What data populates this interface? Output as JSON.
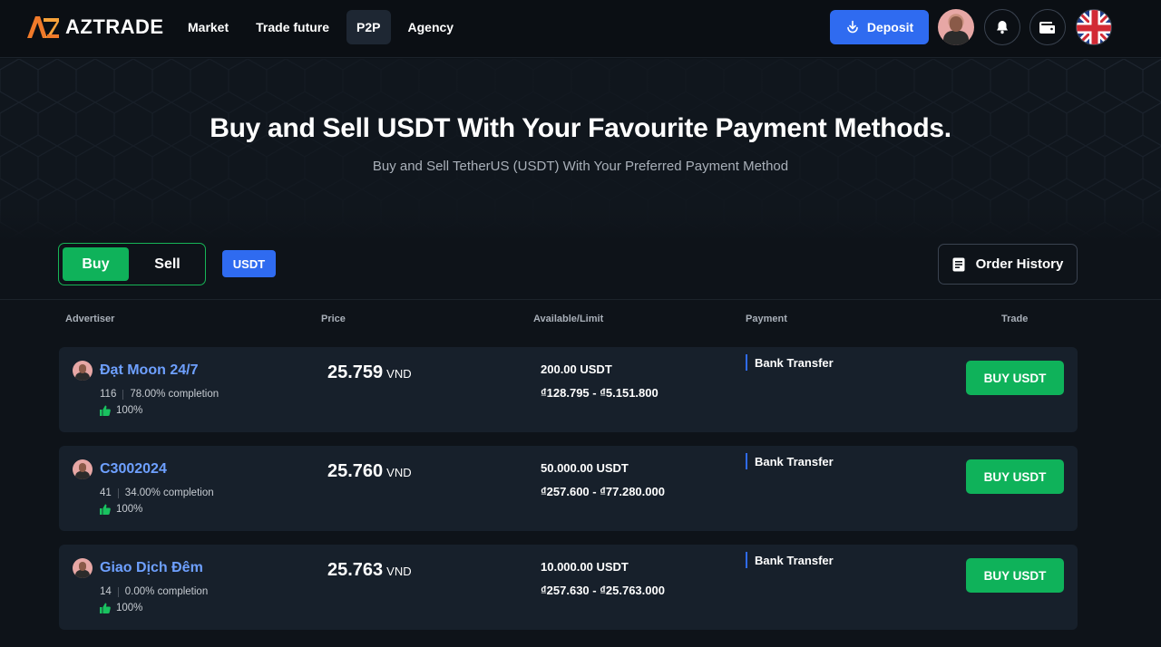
{
  "header": {
    "brand": "AZTRADE",
    "nav": [
      {
        "label": "Market",
        "active": false
      },
      {
        "label": "Trade future",
        "active": false
      },
      {
        "label": "P2P",
        "active": true
      },
      {
        "label": "Agency",
        "active": false
      }
    ],
    "deposit_label": "Deposit",
    "icons": [
      "deposit-icon",
      "avatar",
      "bell-icon",
      "wallet-icon",
      "uk-flag-icon"
    ]
  },
  "hero": {
    "title": "Buy and Sell USDT With Your Favourite Payment Methods.",
    "subtitle": "Buy and Sell TetherUS (USDT) With Your Preferred Payment Method"
  },
  "controls": {
    "buy_label": "Buy",
    "sell_label": "Sell",
    "selected_side": "Buy",
    "asset": "USDT",
    "order_history_label": "Order History"
  },
  "table": {
    "columns": [
      "Advertiser",
      "Price",
      "Available/Limit",
      "Payment",
      "Trade"
    ],
    "rows": [
      {
        "name": "Đạt Moon 24/7",
        "orders": "116",
        "completion": "78.00% completion",
        "rating": "100%",
        "price": "25.759",
        "currency": "VND",
        "available": "200.00 USDT",
        "limit": "₫128.795 - ₫5.151.800",
        "payment": "Bank Transfer",
        "action": "BUY USDT"
      },
      {
        "name": "C3002024",
        "orders": "41",
        "completion": "34.00% completion",
        "rating": "100%",
        "price": "25.760",
        "currency": "VND",
        "available": "50.000.00 USDT",
        "limit": "₫257.600 - ₫77.280.000",
        "payment": "Bank Transfer",
        "action": "BUY USDT"
      },
      {
        "name": "Giao Dịch Đêm",
        "orders": "14",
        "completion": "0.00% completion",
        "rating": "100%",
        "price": "25.763",
        "currency": "VND",
        "available": "10.000.00 USDT",
        "limit": "₫257.630 - ₫25.763.000",
        "payment": "Bank Transfer",
        "action": "BUY USDT"
      }
    ]
  },
  "colors": {
    "background": "#0e1319",
    "accent_blue": "#2f6bf0",
    "accent_green": "#0fb25a",
    "advertiser_link": "#6ea0ff",
    "row_bg": "#17202b"
  }
}
